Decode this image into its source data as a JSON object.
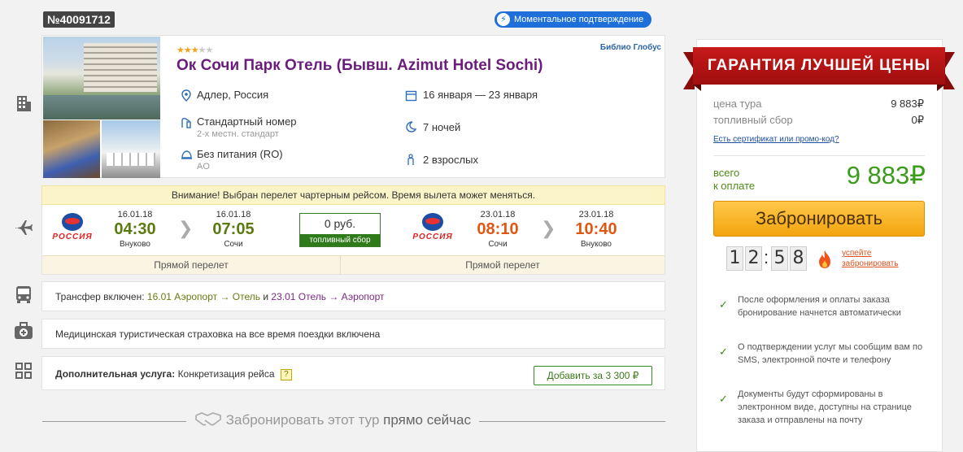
{
  "tour": {
    "number": "№40091712",
    "instant_label": "Моментальное подтверждение"
  },
  "hotel": {
    "stars": 3,
    "stars_max": 5,
    "name": "Ок Сочи Парк Отель (Бывш. Azimut Hotel Sochi)",
    "operator": "Библио Глобус",
    "location": "Адлер, Россия",
    "dates": "16 января — 23 января",
    "room": "Стандартный номер",
    "room_sub": "2-х местн. стандарт",
    "nights": "7 ночей",
    "meal": "Без питания (RO)",
    "meal_sub": "AO",
    "guests": "2 взрослых"
  },
  "flights": {
    "warning": "Внимание! Выбран перелет чартерным рейсом. Время вылета может меняться.",
    "airline": "РОССИЯ",
    "outbound": {
      "dep_date": "16.01.18",
      "dep_time": "04:30",
      "dep_city": "Внуково",
      "arr_date": "16.01.18",
      "arr_time": "07:05",
      "arr_city": "Сочи",
      "direct_label": "Прямой перелет"
    },
    "fuel": {
      "value": "0 руб.",
      "label": "топливный сбор"
    },
    "return": {
      "dep_date": "23.01.18",
      "dep_time": "08:10",
      "dep_city": "Сочи",
      "arr_date": "23.01.18",
      "arr_time": "10:40",
      "arr_city": "Внуково",
      "direct_label": "Прямой перелет"
    }
  },
  "transfer": {
    "prefix": "Трансфер включен:",
    "out_date": "16.01",
    "out_route": "Аэропорт → Отель",
    "and": "и",
    "ret_date": "23.01",
    "ret_route": "Отель → Аэропорт"
  },
  "insurance": "Медицинская туристическая страховка на все время поездки включена",
  "extra": {
    "label": "Дополнительная услуга:",
    "value": "Конкретизация рейса",
    "help": "?",
    "add_button": "Добавить за 3 300 ₽"
  },
  "footer": {
    "part1": "Забронировать этот тур",
    "part2": "прямо сейчас"
  },
  "price_panel": {
    "ribbon": "ГАРАНТИЯ ЛУЧШЕЙ ЦЕНЫ",
    "tour_price_label": "цена тура",
    "tour_price_value": "9 883₽",
    "fuel_label": "топливный сбор",
    "fuel_value": "0₽",
    "promo_link": "Есть сертификат или промо-код?",
    "total_label_1": "всего",
    "total_label_2": "к оплате",
    "total_value": "9 883₽",
    "book_button": "Забронировать",
    "timer": [
      "1",
      "2",
      "5",
      "8"
    ],
    "timer_sep": ":",
    "hurry_1": "успейте",
    "hurry_2": "забронировать",
    "notes": [
      "После оформления и оплаты заказа бронирование начнется автоматически",
      "О подтверждении услуг мы сообщим вам по SMS, электронной почте и телефону",
      "Документы будут сформированы в электронном виде, доступны на странице заказа и отправлены на почту"
    ]
  },
  "colors": {
    "accent_purple": "#6a1d7a",
    "green": "#3b9b1a",
    "ribbon_red": "#c61a1a",
    "button_orange": "#f3a40e"
  },
  "icons": [
    "building-icon",
    "plane-icon",
    "bus-icon",
    "medkit-icon",
    "grid-icon",
    "location-icon",
    "calendar-icon",
    "room-icon",
    "moon-icon",
    "meal-icon",
    "person-icon",
    "bolt-icon",
    "handshake-icon",
    "fire-icon",
    "check-icon"
  ]
}
